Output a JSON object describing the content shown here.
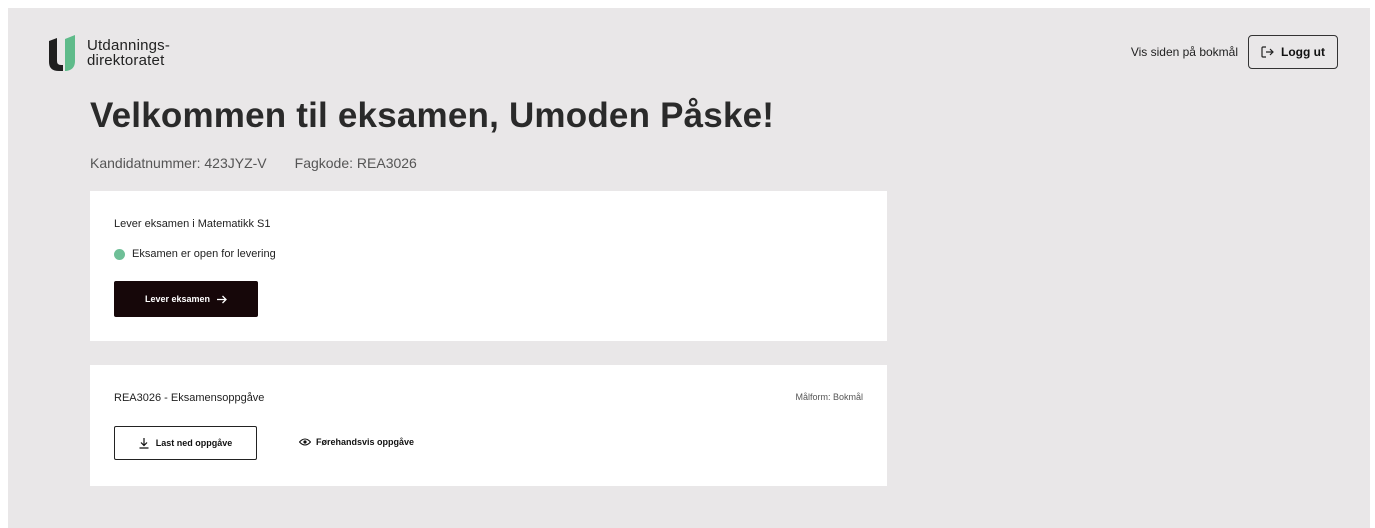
{
  "header": {
    "logo": {
      "line1": "Utdannings-",
      "line2": "direktoratet",
      "colors": {
        "dark": "#1f1f1f",
        "green": "#5fbb8a"
      }
    },
    "language_link": "Vis siden på bokmål",
    "logout": {
      "label": "Logg ut",
      "icon": "logout-icon"
    }
  },
  "main": {
    "title": "Velkommen til eksamen, Umoden Påske!",
    "candidate_number": "Kandidatnummer: 423JYZ-V",
    "subject_code": "Fagkode: REA3026"
  },
  "submit_card": {
    "heading": "Lever eksamen i Matematikk S1",
    "status": {
      "text": "Eksamen er open for levering",
      "color": "#6ebf97"
    },
    "button": {
      "label": "Lever eksamen",
      "icon": "arrow-right-icon"
    }
  },
  "task_card": {
    "heading": "REA3026 - Eksamensoppgåve",
    "language_form": "Målform: Bokmål",
    "download": {
      "label": "Last ned oppgåve",
      "icon": "download-icon"
    },
    "preview": {
      "label": "Førehandsvis oppgåve",
      "icon": "eye-icon"
    }
  },
  "colors": {
    "background": "#e9e7e8",
    "card": "#ffffff",
    "primary_button": "#160709"
  }
}
